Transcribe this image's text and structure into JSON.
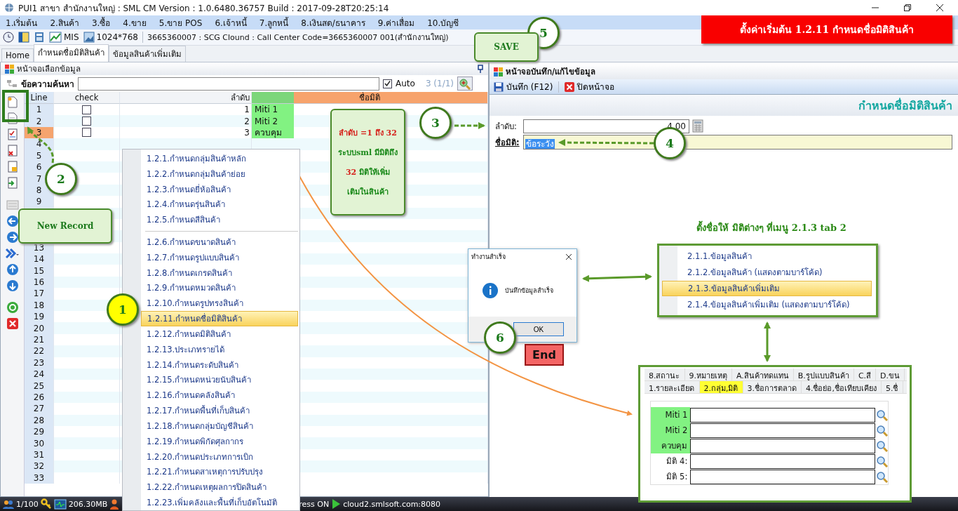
{
  "window": {
    "title": "PUI1 สาขา สำนักงานใหญ่ : SML CM Version : 1.0.6480.36757  Build : 2017-09-28T20:25:14"
  },
  "menu_bar": [
    "1.เริ่มต้น",
    "2.สินค้า",
    "3.ซื้อ",
    "4.ขาย",
    "5.ขาย POS",
    "6.เจ้าหนี้",
    "7.ลูกหนี้",
    "8.เงินสด/ธนาคาร",
    "9.ค่าเสื่อม",
    "10.บัญชี"
  ],
  "toolbar": {
    "mis": "MIS",
    "resolution": "1024*768",
    "info": "3665360007 : SCG Clound : Call Center Code=3665360007 001(สำนักงานใหญ่)"
  },
  "banner": "ตั้งค่าเริ่มต้น  1.2.11 กำหนดชื่อมิติสินค้า",
  "tabs": [
    {
      "label": "Home",
      "selected": false
    },
    {
      "label": "กำหนดชื่อมิติสินค้า",
      "selected": true
    },
    {
      "label": "ข้อมูลสินค้าเพิ่มเติม",
      "selected": false
    }
  ],
  "list_panel": {
    "title": "หน้าจอเลือกข้อมูล",
    "search_label": "ข้อความค้นหา",
    "auto": {
      "label": "Auto",
      "checked": true
    },
    "count": "3 (1/1)",
    "columns": [
      "Line",
      "check",
      "ลำดับ",
      "ชื่อมิติ"
    ],
    "rows": [
      {
        "kind": "record",
        "line": "1",
        "checked": false,
        "order": "1",
        "name": "Miti 1",
        "highlighted": true,
        "selected": false
      },
      {
        "kind": "record",
        "line": "2",
        "checked": false,
        "order": "2",
        "name": "Miti 2",
        "highlighted": true,
        "selected": false
      },
      {
        "kind": "record",
        "line": "3",
        "checked": false,
        "order": "3",
        "name": "ควบคุม",
        "highlighted": true,
        "selected": true
      },
      {
        "kind": "blank",
        "line": "4",
        "selected": false
      },
      {
        "kind": "blank",
        "line": "5",
        "selected": false
      },
      {
        "kind": "blank",
        "line": "6",
        "selected": false
      },
      {
        "kind": "blank",
        "line": "7",
        "selected": false
      },
      {
        "kind": "blank",
        "line": "8",
        "selected": false
      },
      {
        "kind": "blank",
        "line": "9",
        "selected": false
      },
      {
        "kind": "covered"
      },
      {
        "kind": "covered"
      },
      {
        "kind": "covered"
      },
      {
        "kind": "blank",
        "line": "13",
        "selected": false
      },
      {
        "kind": "blank",
        "line": "14",
        "selected": false
      },
      {
        "kind": "blank",
        "line": "15",
        "selected": false
      },
      {
        "kind": "blank",
        "line": "16",
        "selected": false
      },
      {
        "kind": "blank",
        "line": "17",
        "selected": false
      },
      {
        "kind": "blank",
        "line": "18",
        "selected": false
      },
      {
        "kind": "blank",
        "line": "19",
        "selected": false
      },
      {
        "kind": "blank",
        "line": "20",
        "selected": false
      },
      {
        "kind": "blank",
        "line": "21",
        "selected": false
      },
      {
        "kind": "blank",
        "line": "22",
        "selected": false
      },
      {
        "kind": "blank",
        "line": "23",
        "selected": false
      },
      {
        "kind": "blank",
        "line": "24",
        "selected": false
      },
      {
        "kind": "blank",
        "line": "25",
        "selected": false
      },
      {
        "kind": "blank",
        "line": "26",
        "selected": false
      },
      {
        "kind": "blank",
        "line": "27",
        "selected": false
      },
      {
        "kind": "blank",
        "line": "28",
        "selected": false
      },
      {
        "kind": "blank",
        "line": "29",
        "selected": false
      },
      {
        "kind": "blank",
        "line": "30",
        "selected": false
      },
      {
        "kind": "blank",
        "line": "31",
        "selected": false
      },
      {
        "kind": "blank",
        "line": "32",
        "selected": false
      },
      {
        "kind": "blank",
        "line": "33",
        "selected": false
      }
    ]
  },
  "form_panel": {
    "title": "หน้าจอบันทึก/แก้ไขข้อมูล",
    "save_button": "บันทึก (F12)",
    "close_button": "ปิดหน้าจอ",
    "heading": "กำหนดชื่อมิติสินค้า",
    "fields": [
      {
        "kind": "number",
        "label": "ลำดับ:",
        "value": "4.00"
      },
      {
        "kind": "text",
        "label": "ชื่อมิติ:",
        "value": "ข้อระวัง"
      }
    ]
  },
  "context_menu": {
    "groups": [
      [
        {
          "label": "1.2.1.กำหนดกลุ่มสินค้าหลัก",
          "selected": false
        },
        {
          "label": "1.2.2.กำหนดกลุ่มสินค้าย่อย",
          "selected": false
        },
        {
          "label": "1.2.3.กำหนดยี่ห้อสินค้า",
          "selected": false
        },
        {
          "label": "1.2.4.กำหนดรุ่นสินค้า",
          "selected": false
        },
        {
          "label": "1.2.5.กำหนดสีสินค้า",
          "selected": false
        }
      ],
      [
        {
          "label": "1.2.6.กำหนดขนาดสินค้า",
          "selected": false
        },
        {
          "label": "1.2.7.กำหนดรูปแบบสินค้า",
          "selected": false
        },
        {
          "label": "1.2.8.กำหนดเกรดสินค้า",
          "selected": false
        },
        {
          "label": "1.2.9.กำหนดหมวดสินค้า",
          "selected": false
        },
        {
          "label": "1.2.10.กำหนดรูปทรงสินค้า",
          "selected": false
        },
        {
          "label": "1.2.11.กำหนดชื่อมิติสินค้า",
          "selected": true
        },
        {
          "label": "1.2.12.กำหนดมิติสินค้า",
          "selected": false
        },
        {
          "label": "1.2.13.ประเภทรายได้",
          "selected": false
        },
        {
          "label": "1.2.14.กำหนดระดับสินค้า",
          "selected": false
        },
        {
          "label": "1.2.15.กำหนดหน่วยนับสินค้า",
          "selected": false
        },
        {
          "label": "1.2.16.กำหนดคลังสินค้า",
          "selected": false
        },
        {
          "label": "1.2.17.กำหนดพื้นที่เก็บสินค้า",
          "selected": false
        },
        {
          "label": "1.2.18.กำหนดกลุ่มบัญชีสินค้า",
          "selected": false
        },
        {
          "label": "1.2.19.กำหนดพิกัดศุลกากร",
          "selected": false
        },
        {
          "label": "1.2.20.กำหนดประเภทการเบิก",
          "selected": false
        },
        {
          "label": "1.2.21.กำหนดสาเหตุการปรับปรุง",
          "selected": false
        },
        {
          "label": "1.2.22.กำหนดเหตุผลการปิดสินค้า",
          "selected": false
        },
        {
          "label": "1.2.23.เพิ่มคลังและพื้นที่เก็บอัตโนมัติ",
          "selected": false
        }
      ]
    ]
  },
  "dialog": {
    "title": "ทำงานสำเร็จ",
    "message": "บันทึกข้อมูลสำเร็จ",
    "button": "OK"
  },
  "end_button": "End",
  "note_heading": "ตั้งชื่อให้ มิติต่างๆ ที่เมนู 2.1.3 tab 2",
  "item_menu": [
    {
      "label": "2.1.1.ข้อมูลสินค้า",
      "selected": false
    },
    {
      "label": "2.1.2.ข้อมูลสินค้า (แสดงตามบาร์โค้ด)",
      "selected": false
    },
    {
      "label": "2.1.3.ข้อมูลสินค้าเพิ่มเติม",
      "selected": true
    },
    {
      "label": "2.1.4.ข้อมูลสินค้าเพิ่มเติม (แสดงตามบาร์โค้ด)",
      "selected": false
    }
  ],
  "item_form": {
    "tab_rows": [
      [
        {
          "label": "8.สถานะ",
          "selected": false
        },
        {
          "label": "9.หมายเหตุ",
          "selected": false
        },
        {
          "label": "A.สินค้าทดแทน",
          "selected": false
        },
        {
          "label": "B.รูปแบบสินค้า",
          "selected": false
        },
        {
          "label": "C.สี",
          "selected": false
        },
        {
          "label": "D.ขน",
          "selected": false
        }
      ],
      [
        {
          "label": "1.รายละเอียด",
          "selected": false
        },
        {
          "label": "2.กลุ่ม,มิติ",
          "selected": true
        },
        {
          "label": "3.ชื่อการตลาด",
          "selected": false
        },
        {
          "label": "4.ชื่อย่อ,ชื่อเทียบเคียง",
          "selected": false
        },
        {
          "label": "5.ชื่",
          "selected": false
        }
      ]
    ],
    "fields": [
      {
        "label": "Miti 1",
        "highlighted": true
      },
      {
        "label": "Miti 2",
        "highlighted": true
      },
      {
        "label": "ควบคุม",
        "highlighted": true
      },
      {
        "label": "มิติ 4:",
        "highlighted": false
      },
      {
        "label": "มิติ 5:",
        "highlighted": false
      }
    ]
  },
  "annotations": [
    {
      "kind": "number",
      "text": "1",
      "color": "#ffff00"
    },
    {
      "kind": "number",
      "text": "2",
      "color": "#ffffff"
    },
    {
      "kind": "number",
      "text": "3",
      "color": "#ffffff"
    },
    {
      "kind": "number",
      "text": "4",
      "color": "#ffffff"
    },
    {
      "kind": "number",
      "text": "5",
      "color": "#ffffff"
    },
    {
      "kind": "number",
      "text": "6",
      "color": "#ffffff"
    },
    {
      "kind": "label",
      "text": "SAVE"
    },
    {
      "kind": "label",
      "text": "New Record"
    },
    {
      "kind": "note",
      "lines": [
        [
          {
            "text": "ลำดับ =1 ถึง  32",
            "color": "#d6221c"
          }
        ],
        [
          {
            "text": "ระบบsml มีมิติถึง",
            "color": "#1c8a1c"
          }
        ],
        [
          {
            "text": "32",
            "color": "#d6221c"
          },
          {
            "text": "  มิติให้เพิ่ม",
            "color": "#1c8a1c"
          }
        ],
        [
          {
            "text": "เติมในสินค้า",
            "color": "#1c8a1c"
          }
        ]
      ]
    }
  ],
  "status_bar": {
    "users": "1/100",
    "memory": "206.30MB",
    "mode": "ress ON",
    "server": "cloud2.smlsoft.com:8080"
  }
}
